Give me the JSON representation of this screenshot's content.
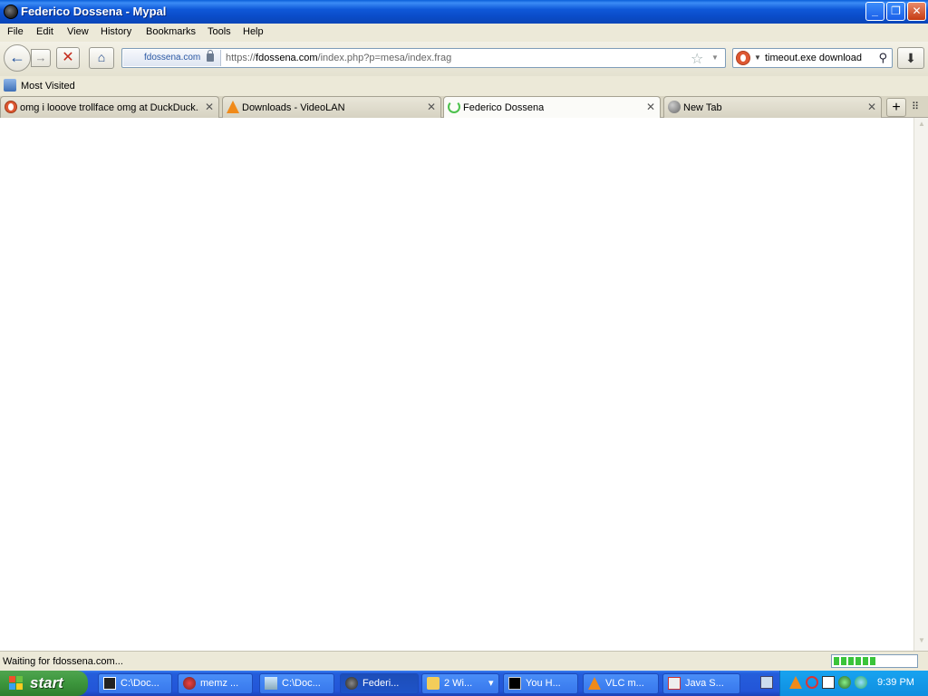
{
  "window": {
    "title": "Federico Dossena - Mypal",
    "minimize_glyph": "_",
    "maximize_glyph": "❐",
    "close_glyph": "✕"
  },
  "menu": [
    "File",
    "Edit",
    "View",
    "History",
    "Bookmarks",
    "Tools",
    "Help"
  ],
  "nav": {
    "back_glyph": "←",
    "forward_glyph": "→",
    "stop_glyph": "✕",
    "home_glyph": "⌂",
    "identity": "fdossena.com",
    "url_prefix": "https://",
    "url_host": "fdossena.com",
    "url_path": "/index.php?p=mesa/index.frag",
    "star_glyph": "☆",
    "dropdown_glyph": "▼",
    "search_text": "timeout.exe download",
    "search_drop_glyph": "▼",
    "search_glyph": "⚲",
    "download_glyph": "⬇"
  },
  "bookmarks": {
    "most_visited": "Most Visited"
  },
  "tabs": [
    {
      "label": "omg i looove trollface omg at DuckDuck...",
      "icon": "duckduckgo-icon",
      "close": "✕"
    },
    {
      "label": "Downloads - VideoLAN",
      "icon": "vlc-cone-icon",
      "close": "✕"
    },
    {
      "label": "Federico Dossena",
      "icon": "loading-spinner-icon",
      "close": "✕",
      "active": true
    },
    {
      "label": "New Tab",
      "icon": "globe-icon",
      "close": "✕"
    }
  ],
  "tab_controls": {
    "new_tab_glyph": "+",
    "all_tabs_glyph": "⠿"
  },
  "scrollbar": {
    "up_glyph": "▲",
    "down_glyph": "▼"
  },
  "status": {
    "text": "Waiting for fdossena.com...",
    "progress": 0.52
  },
  "taskbar": {
    "start_label": "start",
    "tasks": [
      {
        "label": "C:\\Doc...",
        "icon": "7zip-icon"
      },
      {
        "label": "memz ...",
        "icon": "paint-icon"
      },
      {
        "label": "C:\\Doc...",
        "icon": "notepad-icon"
      },
      {
        "label": "Federi...",
        "icon": "mypal-icon",
        "active": true
      },
      {
        "label": "2 Wi...",
        "icon": "folder-icon"
      },
      {
        "label": "You H...",
        "icon": "cmd-icon"
      },
      {
        "label": "VLC m...",
        "icon": "vlc-cone-icon"
      },
      {
        "label": "Java S...",
        "icon": "java-icon"
      }
    ],
    "group_arrow_glyph": "▾",
    "clock": "9:39 PM"
  }
}
